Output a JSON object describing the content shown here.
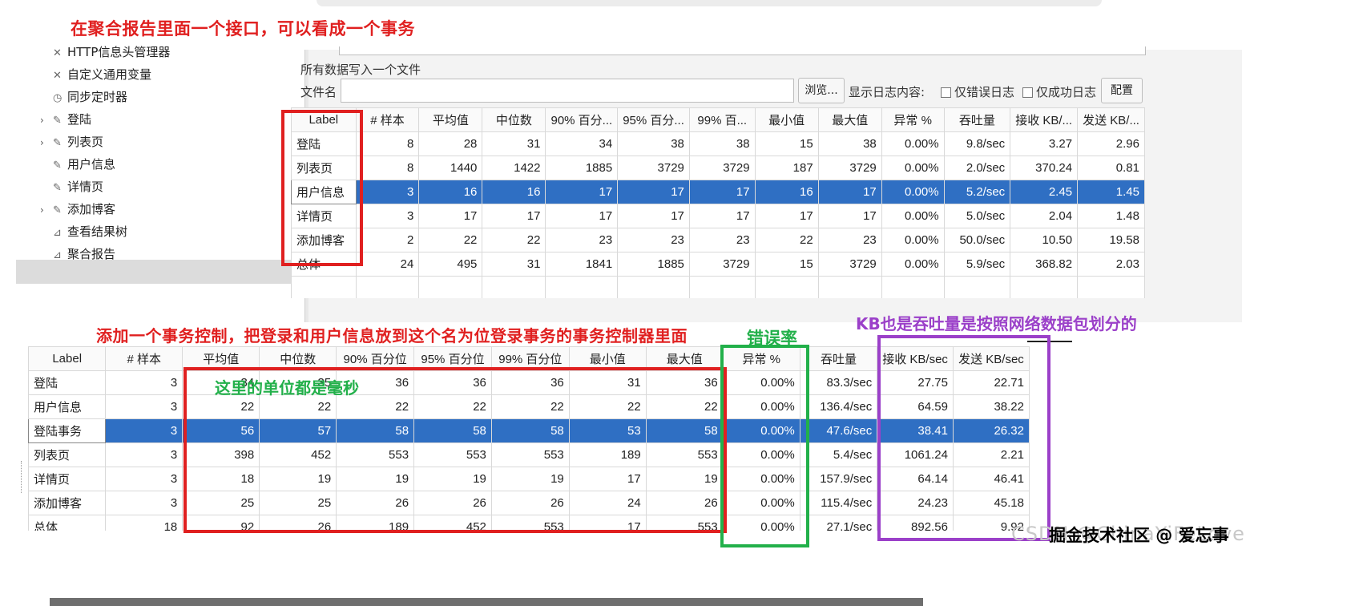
{
  "annotations": {
    "top_title": "在聚合报告里面一个接口，可以看成一个事务",
    "middle_title": "添加一个事务控制，把登录和用户信息放到这个名为位登录事务的事务控制器里面",
    "error_rate": "错误率",
    "kb_note": "KB也是吞吐量是按照网络数据包划分的",
    "unit_note": "这里的单位都是毫秒"
  },
  "tree": {
    "items": [
      {
        "label": "HTTP信息头管理器",
        "icon": "wrench-icon",
        "arrow": ""
      },
      {
        "label": "自定义通用变量",
        "icon": "wrench-icon",
        "arrow": ""
      },
      {
        "label": "同步定时器",
        "icon": "clock-icon",
        "arrow": ""
      },
      {
        "label": "登陆",
        "icon": "pen-icon",
        "arrow": "›"
      },
      {
        "label": "列表页",
        "icon": "pen-icon",
        "arrow": "›"
      },
      {
        "label": "用户信息",
        "icon": "pen-icon",
        "arrow": ""
      },
      {
        "label": "详情页",
        "icon": "pen-icon",
        "arrow": ""
      },
      {
        "label": "添加博客",
        "icon": "pen-icon",
        "arrow": "›"
      },
      {
        "label": "查看结果树",
        "icon": "chart-icon",
        "arrow": ""
      },
      {
        "label": "聚合报告",
        "icon": "chart-icon",
        "arrow": ""
      }
    ]
  },
  "file_panel": {
    "section_label": "所有数据写入一个文件",
    "file_label": "文件名",
    "file_value": "",
    "browse": "浏览...",
    "log_label": "显示日志内容:",
    "errors_only": "仅错误日志",
    "success_only": "仅成功日志",
    "config": "配置"
  },
  "table1": {
    "headers": [
      "Label",
      "# 样本",
      "平均值",
      "中位数",
      "90% 百分...",
      "95% 百分...",
      "99% 百...",
      "最小值",
      "最大值",
      "异常 %",
      "吞吐量",
      "接收 KB/...",
      "发送 KB/..."
    ],
    "rows": [
      [
        "登陆",
        "8",
        "28",
        "31",
        "34",
        "38",
        "38",
        "15",
        "38",
        "0.00%",
        "9.8/sec",
        "3.27",
        "2.96"
      ],
      [
        "列表页",
        "8",
        "1440",
        "1422",
        "1885",
        "3729",
        "3729",
        "187",
        "3729",
        "0.00%",
        "2.0/sec",
        "370.24",
        "0.81"
      ],
      [
        "用户信息",
        "3",
        "16",
        "16",
        "17",
        "17",
        "17",
        "16",
        "17",
        "0.00%",
        "5.2/sec",
        "2.45",
        "1.45"
      ],
      [
        "详情页",
        "3",
        "17",
        "17",
        "17",
        "17",
        "17",
        "17",
        "17",
        "0.00%",
        "5.0/sec",
        "2.04",
        "1.48"
      ],
      [
        "添加博客",
        "2",
        "22",
        "22",
        "23",
        "23",
        "23",
        "22",
        "23",
        "0.00%",
        "50.0/sec",
        "10.50",
        "19.58"
      ],
      [
        "总体",
        "24",
        "495",
        "31",
        "1841",
        "1885",
        "3729",
        "15",
        "3729",
        "0.00%",
        "5.9/sec",
        "368.82",
        "2.03"
      ]
    ],
    "selected_row": 2
  },
  "table2": {
    "headers": [
      "Label",
      "# 样本",
      "平均值",
      "中位数",
      "90% 百分位",
      "95% 百分位",
      "99% 百分位",
      "最小值",
      "最大值",
      "异常 %",
      "吞吐量",
      "接收 KB/sec",
      "发送 KB/sec"
    ],
    "rows": [
      [
        "登陆",
        "3",
        "34",
        "35",
        "36",
        "36",
        "36",
        "31",
        "36",
        "0.00%",
        "83.3/sec",
        "27.75",
        "22.71"
      ],
      [
        "用户信息",
        "3",
        "22",
        "22",
        "22",
        "22",
        "22",
        "22",
        "22",
        "0.00%",
        "136.4/sec",
        "64.59",
        "38.22"
      ],
      [
        "登陆事务",
        "3",
        "56",
        "57",
        "58",
        "58",
        "58",
        "53",
        "58",
        "0.00%",
        "47.6/sec",
        "38.41",
        "26.32"
      ],
      [
        "列表页",
        "3",
        "398",
        "452",
        "553",
        "553",
        "553",
        "189",
        "553",
        "0.00%",
        "5.4/sec",
        "1061.24",
        "2.21"
      ],
      [
        "详情页",
        "3",
        "18",
        "19",
        "19",
        "19",
        "19",
        "17",
        "19",
        "0.00%",
        "157.9/sec",
        "64.14",
        "46.41"
      ],
      [
        "添加博客",
        "3",
        "25",
        "25",
        "26",
        "26",
        "26",
        "24",
        "26",
        "0.00%",
        "115.4/sec",
        "24.23",
        "45.18"
      ],
      [
        "总体",
        "18",
        "92",
        "26",
        "189",
        "452",
        "553",
        "17",
        "553",
        "0.00%",
        "27.1/sec",
        "892.56",
        "9.92"
      ]
    ],
    "selected_row": 2
  },
  "watermark": {
    "text": "掘金技术社区 @ 爱忘事",
    "bg_text": "CSDN @ChinaYiFeLove"
  },
  "colors": {
    "red": "#e02020",
    "green": "#22b04a",
    "purple": "#9b40c9",
    "selection": "#2f6fc3"
  }
}
